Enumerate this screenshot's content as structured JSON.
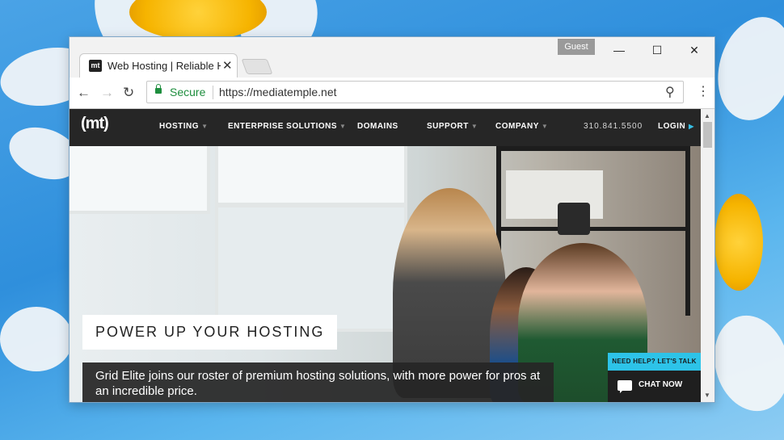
{
  "browser": {
    "tab_favicon": "mt",
    "tab_title": "Web Hosting | Reliable H",
    "profile": "Guest",
    "address_secure_label": "Secure",
    "address_url": "https://mediatemple.net"
  },
  "site": {
    "logo": "(mt)",
    "nav": [
      {
        "label": "HOSTING",
        "has_dropdown": true
      },
      {
        "label": "ENTERPRISE SOLUTIONS",
        "has_dropdown": true
      },
      {
        "label": "DOMAINS",
        "has_dropdown": false
      },
      {
        "label": "SUPPORT",
        "has_dropdown": true
      },
      {
        "label": "COMPANY",
        "has_dropdown": true
      }
    ],
    "phone": "310.841.5500",
    "login": "LOGIN"
  },
  "hero": {
    "headline": "POWER UP YOUR HOSTING",
    "subcopy": "Grid Elite joins our roster of premium hosting solutions, with more power for pros at an incredible price."
  },
  "chat_widget": {
    "help_label": "NEED HELP? LET'S TALK",
    "chat_label": "CHAT NOW"
  },
  "icons": [
    "back-icon",
    "forward-icon",
    "reload-icon",
    "lock-icon",
    "zoom-icon",
    "menu-icon",
    "chat-bubble-icon",
    "close-icon",
    "minimize-icon",
    "maximize-icon"
  ],
  "colors": {
    "accent": "#2dc3e8",
    "nav_bg": "#262626",
    "secure_green": "#1e8e3e"
  }
}
